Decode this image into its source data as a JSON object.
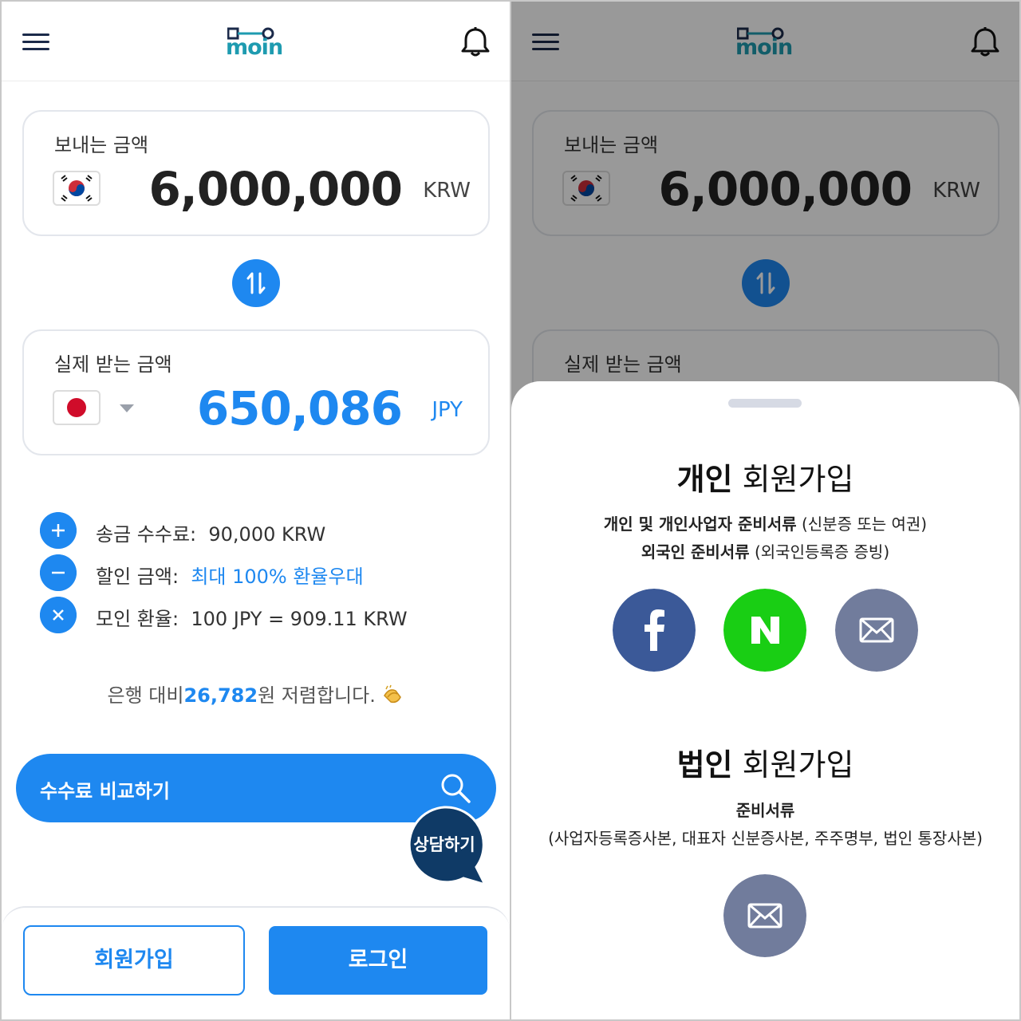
{
  "header": {
    "logo_text": "moin"
  },
  "send": {
    "label": "보내는 금액",
    "amount": "6,000,000",
    "currency": "KRW"
  },
  "receive": {
    "label": "실제 받는 금액",
    "amount": "650,086",
    "currency": "JPY"
  },
  "fees": [
    {
      "label": "송금 수수료:",
      "value": "90,000 KRW"
    },
    {
      "label": "할인 금액:",
      "value": "최대 100% 환율우대"
    },
    {
      "label": "모인 환율:",
      "value": "100 JPY = 909.11 KRW"
    }
  ],
  "saving": {
    "prefix": "은행 대비",
    "amount": "26,782",
    "suffix": "원 저렴합니다."
  },
  "compare_button": "수수료 비교하기",
  "chat_button": "상담하기",
  "bottom": {
    "signup": "회원가입",
    "login": "로그인"
  },
  "sheet": {
    "personal": {
      "title_bold": "개인",
      "title_rest": "회원가입",
      "line1_bold": "개인 및 개인사업자 준비서류",
      "line1_rest": "(신분증 또는 여권)",
      "line2_bold": "외국인 준비서류",
      "line2_rest": "(외국인등록증 증빙)"
    },
    "corporate": {
      "title_bold": "법인",
      "title_rest": "회원가입",
      "line1_bold": "준비서류",
      "line2": "(사업자등록증사본, 대표자 신분증사본, 주주명부, 법인 통장사본)"
    }
  },
  "colors": {
    "primary": "#1e88f0",
    "navy": "#0f3a66",
    "facebook": "#3b5998",
    "naver": "#19ce14",
    "email": "#717c9c"
  }
}
